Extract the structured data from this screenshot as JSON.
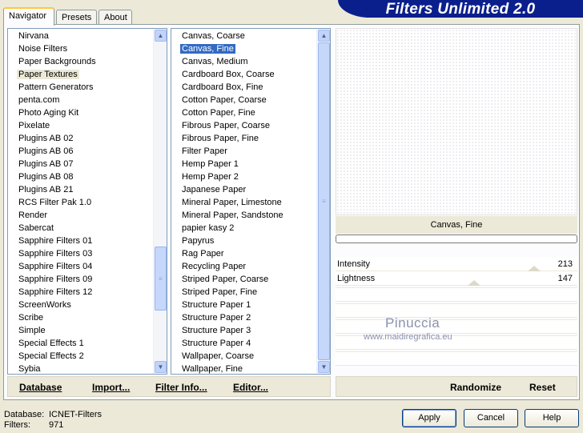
{
  "tabs": [
    {
      "label": "Navigator",
      "active": true
    },
    {
      "label": "Presets",
      "active": false
    },
    {
      "label": "About",
      "active": false
    }
  ],
  "app_title": "Filters Unlimited 2.0",
  "categories": {
    "items": [
      "Nirvana",
      "Noise Filters",
      "Paper Backgrounds",
      "Paper Textures",
      "Pattern Generators",
      "penta.com",
      "Photo Aging Kit",
      "Pixelate",
      "Plugins AB 02",
      "Plugins AB 06",
      "Plugins AB 07",
      "Plugins AB 08",
      "Plugins AB 21",
      "RCS Filter Pak 1.0",
      "Render",
      "Sabercat",
      "Sapphire Filters 01",
      "Sapphire Filters 03",
      "Sapphire Filters 04",
      "Sapphire Filters 09",
      "Sapphire Filters 12",
      "ScreenWorks",
      "Scribe",
      "Simple",
      "Special Effects 1",
      "Special Effects 2",
      "Sybia"
    ],
    "selected": "Paper Textures"
  },
  "filters": {
    "items": [
      "Canvas, Coarse",
      "Canvas, Fine",
      "Canvas, Medium",
      "Cardboard Box, Coarse",
      "Cardboard Box, Fine",
      "Cotton Paper, Coarse",
      "Cotton Paper, Fine",
      "Fibrous Paper, Coarse",
      "Fibrous Paper, Fine",
      "Filter Paper",
      "Hemp Paper 1",
      "Hemp Paper 2",
      "Japanese Paper",
      "Mineral Paper, Limestone",
      "Mineral Paper, Sandstone",
      "papier kasy 2",
      "Papyrus",
      "Rag Paper",
      "Recycling Paper",
      "Striped Paper, Coarse",
      "Striped Paper, Fine",
      "Structure Paper 1",
      "Structure Paper 2",
      "Structure Paper 3",
      "Structure Paper 4",
      "Wallpaper, Coarse",
      "Wallpaper, Fine"
    ],
    "selected": "Canvas, Fine"
  },
  "left_bar": {
    "database": "Database",
    "import": "Import...",
    "filter_info": "Filter Info...",
    "editor": "Editor..."
  },
  "right_bar": {
    "randomize": "Randomize",
    "reset": "Reset"
  },
  "current_filter": "Canvas, Fine",
  "params": [
    {
      "name": "Intensity",
      "value": "213"
    },
    {
      "name": "Lightness",
      "value": "147"
    }
  ],
  "watermark": {
    "name": "Pinuccia",
    "url": "www.maidiregrafica.eu"
  },
  "footer": {
    "database_label": "Database:",
    "database_value": "ICNET-Filters",
    "filters_label": "Filters:",
    "filters_value": "971"
  },
  "buttons": {
    "apply": "Apply",
    "cancel": "Cancel",
    "help": "Help"
  },
  "colors": {
    "banner": "#0b1f8c",
    "selection": "#316ac5"
  }
}
